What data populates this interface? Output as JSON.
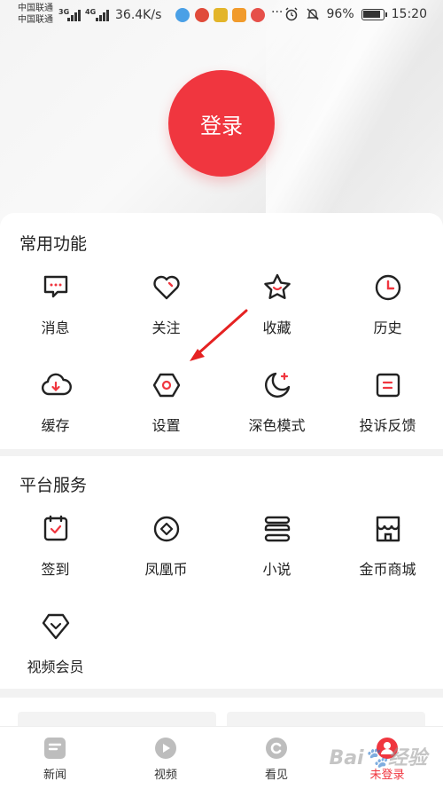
{
  "status_bar": {
    "carrier1": "中国联通",
    "carrier2": "中国联通",
    "net1": "3G",
    "net2": "4G",
    "speed": "36.4K/s",
    "more": "···",
    "battery": "96%",
    "time": "15:20"
  },
  "login": {
    "label": "登录"
  },
  "common": {
    "title": "常用功能",
    "items": [
      {
        "label": "消息",
        "icon": "message-icon"
      },
      {
        "label": "关注",
        "icon": "heart-icon"
      },
      {
        "label": "收藏",
        "icon": "star-icon"
      },
      {
        "label": "历史",
        "icon": "clock-icon"
      },
      {
        "label": "缓存",
        "icon": "cloud-download-icon"
      },
      {
        "label": "设置",
        "icon": "settings-hexagon-icon"
      },
      {
        "label": "深色模式",
        "icon": "moon-icon"
      },
      {
        "label": "投诉反馈",
        "icon": "feedback-icon"
      }
    ]
  },
  "platform": {
    "title": "平台服务",
    "items": [
      {
        "label": "签到",
        "icon": "checkin-icon"
      },
      {
        "label": "凤凰币",
        "icon": "coin-icon"
      },
      {
        "label": "小说",
        "icon": "novel-icon"
      },
      {
        "label": "金币商城",
        "icon": "shop-icon"
      },
      {
        "label": "视频会员",
        "icon": "vip-diamond-icon"
      }
    ]
  },
  "tabs": [
    {
      "label": "新闻",
      "icon": "news-icon"
    },
    {
      "label": "视频",
      "icon": "video-play-icon"
    },
    {
      "label": "看见",
      "icon": "see-icon"
    },
    {
      "label": "未登录",
      "icon": "user-avatar-icon",
      "active": true
    }
  ],
  "colors": {
    "accent": "#f0363f",
    "text": "#222222"
  },
  "watermark": "Bai🐾经验"
}
